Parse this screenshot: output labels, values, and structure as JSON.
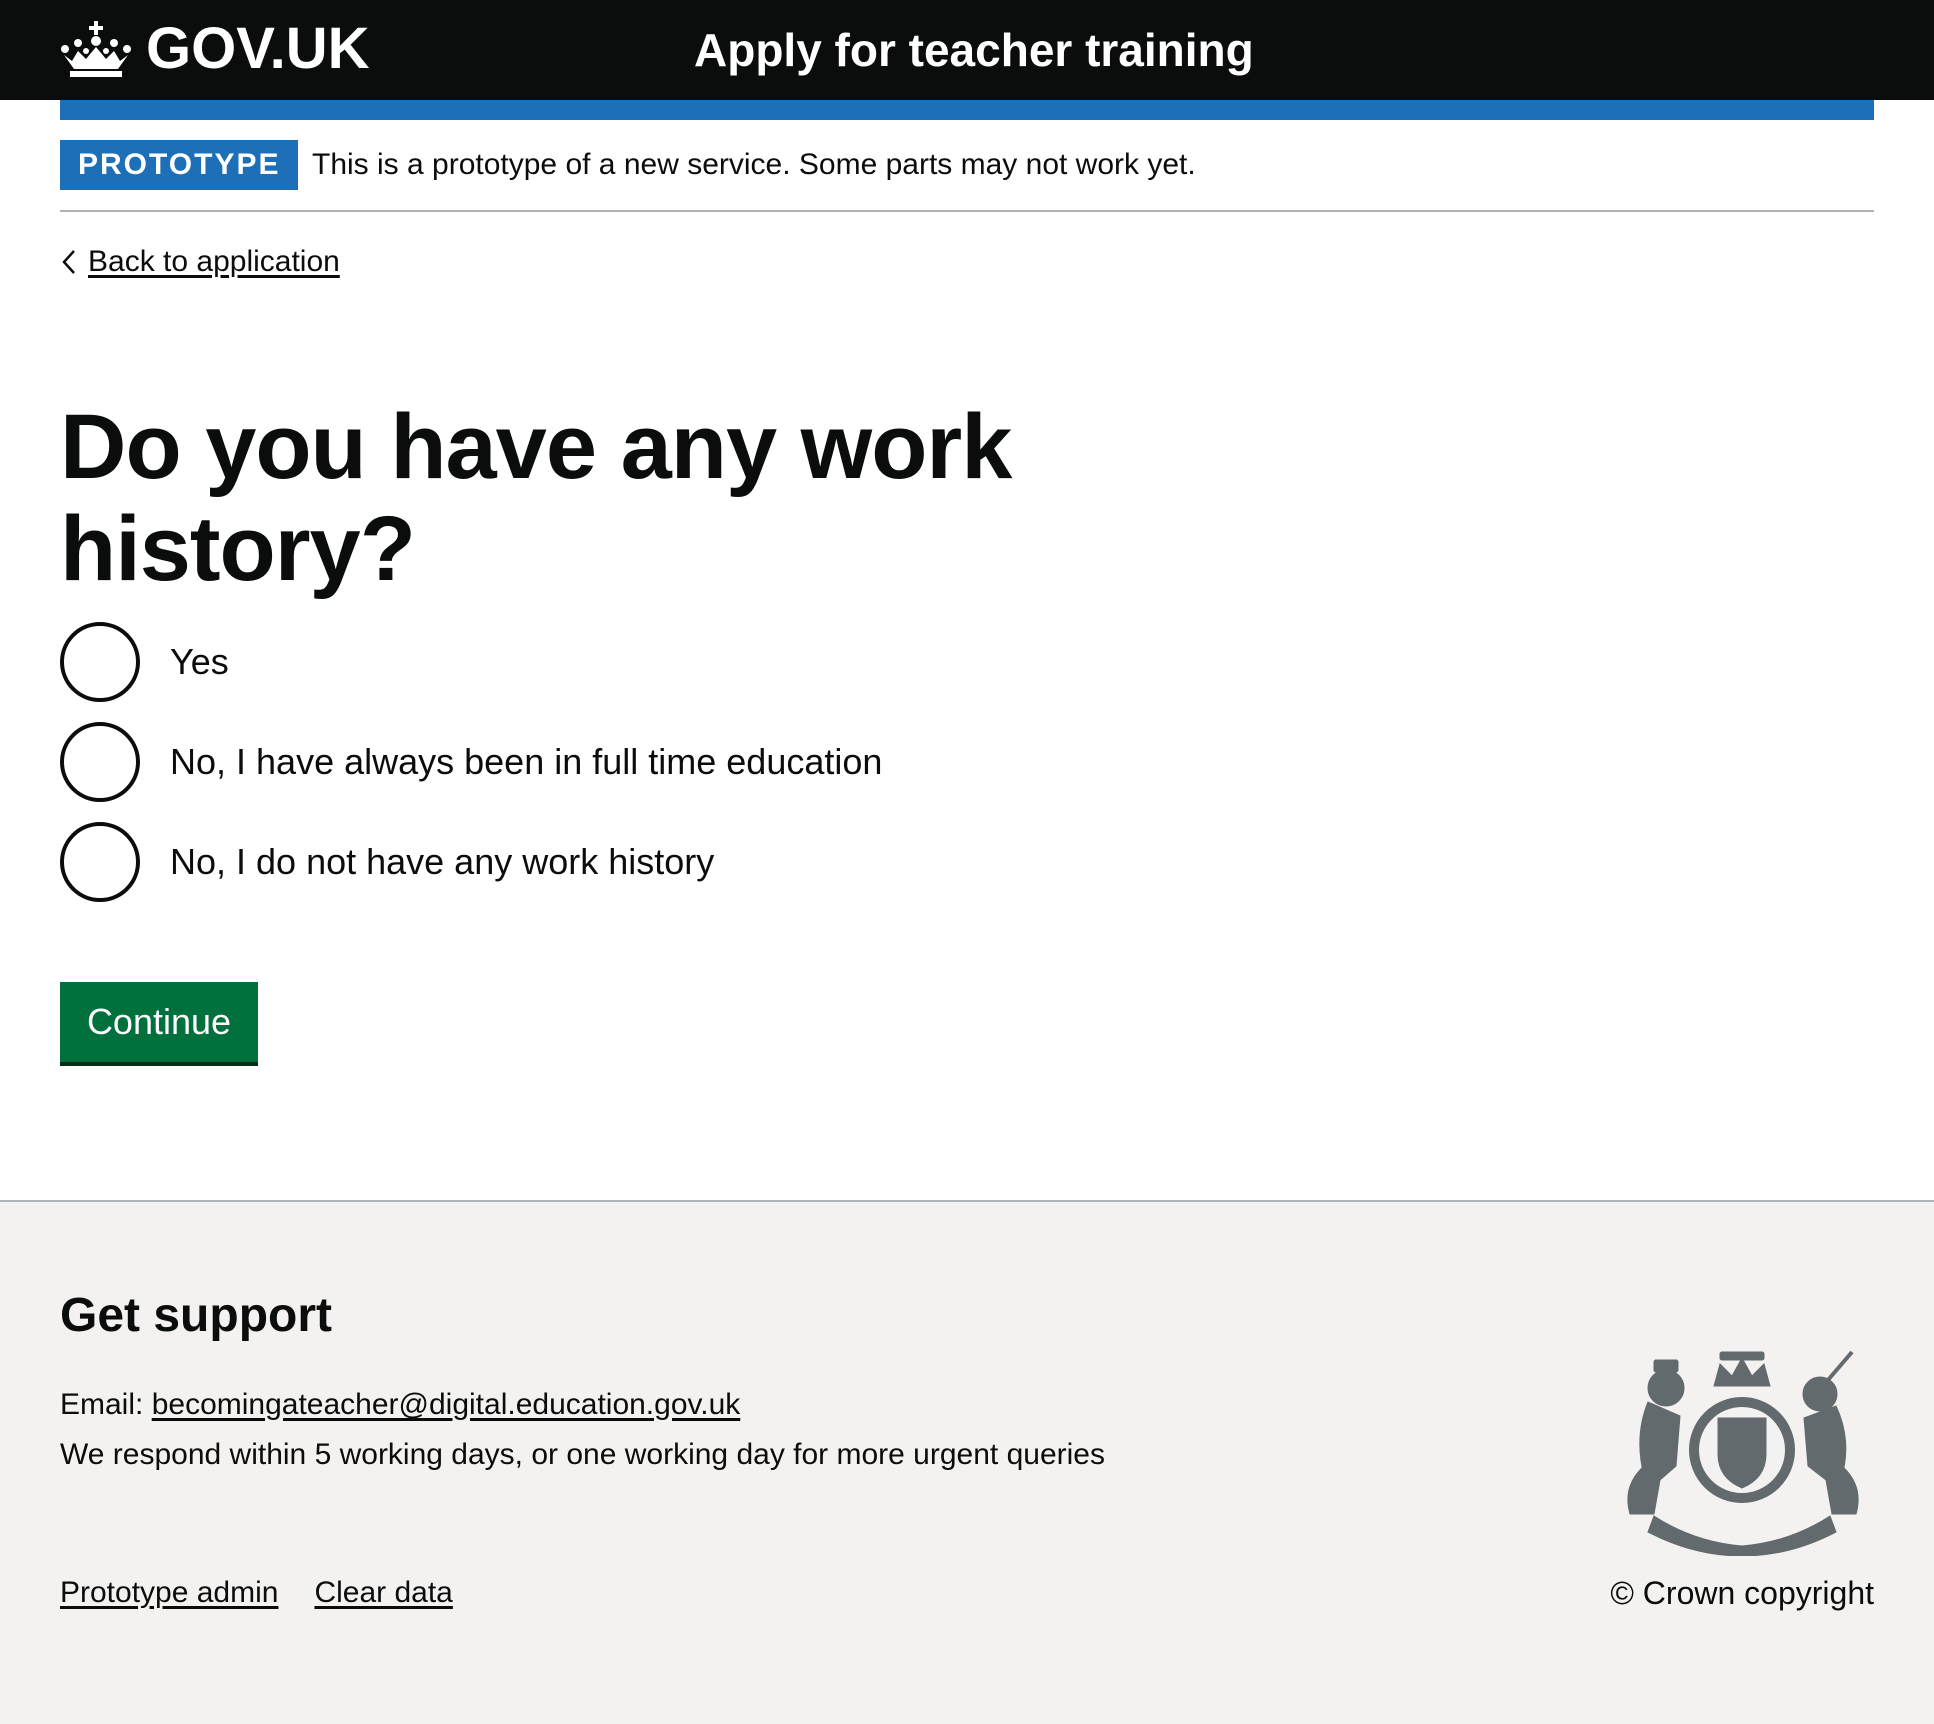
{
  "header": {
    "logo_text": "GOV.UK",
    "logo_icon": "crown-icon",
    "service_name": "Apply for teacher training",
    "background_color": "#0b0c0c",
    "accent_bar_color": "#1d70b8"
  },
  "phase_banner": {
    "tag": "PROTOTYPE",
    "text": "This is a prototype of a new service. Some parts may not work yet.",
    "tag_color": "#1d70b8"
  },
  "back_link": {
    "label": "Back to application",
    "icon": "chevron-left-icon"
  },
  "main": {
    "heading": "Do you have any work history?",
    "radio_options": [
      {
        "label": "Yes",
        "selected": false
      },
      {
        "label": "No, I have always been in full time education",
        "selected": false
      },
      {
        "label": "No, I do not have any work history",
        "selected": false
      }
    ],
    "continue_label": "Continue",
    "button_color": "#00703c"
  },
  "footer": {
    "heading": "Get support",
    "email_label": "Email:",
    "email_address": "becomingateacher@digital.education.gov.uk",
    "response_text": "We respond within 5 working days, or one working day for more urgent queries",
    "links": [
      "Prototype admin",
      "Clear data"
    ],
    "copyright": "© Crown copyright",
    "crest_icon": "royal-coat-of-arms-icon",
    "background_color": "#f3f2f1"
  }
}
